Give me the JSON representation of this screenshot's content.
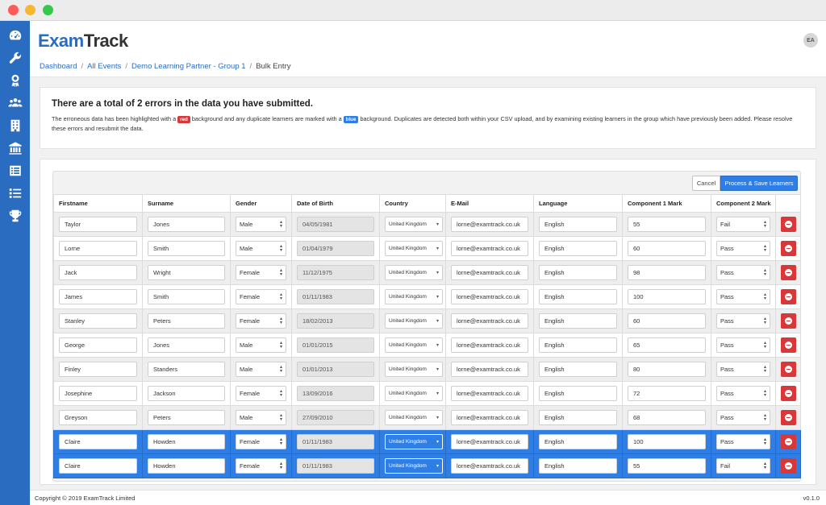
{
  "window": {
    "colors": {
      "close": "#fc5b57",
      "minimize": "#f5b82e",
      "maximize": "#36c84b"
    }
  },
  "sidebar": {
    "color": "#2a6dc0",
    "icons": [
      "dashboard-icon",
      "wrench-icon",
      "award-icon",
      "users-icon",
      "building-icon",
      "bank-icon",
      "list-box-icon",
      "list-icon",
      "trophy-icon"
    ]
  },
  "header": {
    "logo_part1": "Exam",
    "logo_part2": "Track",
    "avatar_initials": "EA",
    "breadcrumb": [
      "Dashboard",
      "All Events",
      "Demo Learning Partner - Group 1",
      "Bulk Entry"
    ]
  },
  "alert": {
    "title": "There are a total of 2 errors in the data you have submitted.",
    "text_before_red": "The erroneous data has been highlighted with a",
    "red_badge": "red",
    "text_between": "background and any duplicate learners are marked with a",
    "blue_badge": "blue",
    "text_after": "background. Duplicates are detected both within your CSV upload, and by examining existing learners in the group which have previously been added. Please resolve these errors and resubmit the data."
  },
  "actions": {
    "cancel": "Cancel",
    "process": "Process & Save Learners"
  },
  "table": {
    "columns": [
      "Firstname",
      "Surname",
      "Gender",
      "Date of Birth",
      "Country",
      "E-Mail",
      "Language",
      "Component 1 Mark",
      "Component 2 Mark",
      ""
    ],
    "rows": [
      {
        "firstname": "Taylor",
        "surname": "Jones",
        "gender": "Male",
        "dob": "04/05/1981",
        "country": "United Kingdom",
        "email": "lorne@examtrack.co.uk",
        "language": "English",
        "c1": "55",
        "c2": "Fail",
        "duplicate": false
      },
      {
        "firstname": "Lorne",
        "surname": "Smith",
        "gender": "Male",
        "dob": "01/04/1979",
        "country": "United Kingdom",
        "email": "lorne@examtrack.co.uk",
        "language": "English",
        "c1": "60",
        "c2": "Pass",
        "duplicate": false
      },
      {
        "firstname": "Jack",
        "surname": "Wright",
        "gender": "Female",
        "dob": "11/12/1975",
        "country": "United Kingdom",
        "email": "lorne@examtrack.co.uk",
        "language": "English",
        "c1": "98",
        "c2": "Pass",
        "duplicate": false
      },
      {
        "firstname": "James",
        "surname": "Smith",
        "gender": "Female",
        "dob": "01/11/1983",
        "country": "United Kingdom",
        "email": "lorne@examtrack.co.uk",
        "language": "English",
        "c1": "100",
        "c2": "Pass",
        "duplicate": false
      },
      {
        "firstname": "Stanley",
        "surname": "Peters",
        "gender": "Female",
        "dob": "18/02/2013",
        "country": "United Kingdom",
        "email": "lorne@examtrack.co.uk",
        "language": "English",
        "c1": "60",
        "c2": "Pass",
        "duplicate": false
      },
      {
        "firstname": "George",
        "surname": "Jones",
        "gender": "Male",
        "dob": "01/01/2015",
        "country": "United Kingdom",
        "email": "lorne@examtrack.co.uk",
        "language": "English",
        "c1": "65",
        "c2": "Pass",
        "duplicate": false
      },
      {
        "firstname": "Finley",
        "surname": "Standers",
        "gender": "Male",
        "dob": "01/01/2013",
        "country": "United Kingdom",
        "email": "lorne@examtrack.co.uk",
        "language": "English",
        "c1": "80",
        "c2": "Pass",
        "duplicate": false
      },
      {
        "firstname": "Josephine",
        "surname": "Jackson",
        "gender": "Female",
        "dob": "13/09/2016",
        "country": "United Kingdom",
        "email": "lorne@examtrack.co.uk",
        "language": "English",
        "c1": "72",
        "c2": "Pass",
        "duplicate": false
      },
      {
        "firstname": "Greyson",
        "surname": "Peters",
        "gender": "Male",
        "dob": "27/09/2010",
        "country": "United Kingdom",
        "email": "lorne@examtrack.co.uk",
        "language": "English",
        "c1": "68",
        "c2": "Pass",
        "duplicate": false
      },
      {
        "firstname": "Claire",
        "surname": "Howden",
        "gender": "Female",
        "dob": "01/11/1983",
        "country": "United Kingdom",
        "email": "lorne@examtrack.co.uk",
        "language": "English",
        "c1": "100",
        "c2": "Pass",
        "duplicate": true
      },
      {
        "firstname": "Claire",
        "surname": "Howden",
        "gender": "Female",
        "dob": "01/11/1983",
        "country": "United Kingdom",
        "email": "lorne@examtrack.co.uk",
        "language": "English",
        "c1": "55",
        "c2": "Fail",
        "duplicate": true
      }
    ]
  },
  "footer": {
    "copyright": "Copyright © 2019 ExamTrack Limited",
    "version": "v0.1.0"
  }
}
